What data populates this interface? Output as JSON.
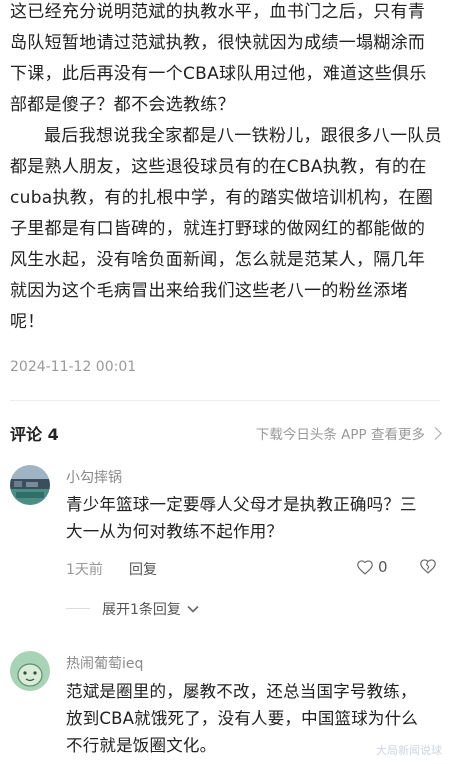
{
  "article": {
    "paragraphs": [
      "这已经充分说明范斌的执教水平，血书门之后，只有青岛队短暂地请过范斌执教，很快就因为成绩一塌糊涂而下课，此后再没有一个CBA球队用过他，难道这些俱乐部都是傻子？都不会选教练？",
      "最后我想说我全家都是八一铁粉儿，跟很多八一队员都是熟人朋友，这些退役球员有的在CBA执教，有的在cuba执教，有的扎根中学，有的踏实做培训机构，在圈子里都是有口皆碑的，就连打野球的做网红的都能做的风生水起，没有啥负面新闻，怎么就是范某人，隔几年就因为这个毛病冒出来给我们这些老八一的粉丝添堵呢！"
    ],
    "date": "2024-11-12 00:01"
  },
  "comments_header": {
    "title": "评论 4",
    "download_link": "下载今日头条 APP 查看更多"
  },
  "comments": [
    {
      "username": "小勾摔锅",
      "text": "青少年篮球一定要辱人父母才是执教正确吗？三大一从为何对教练不起作用？",
      "time": "1天前",
      "reply_label": "回复",
      "likes": "0",
      "expand_label": "展开1条回复"
    },
    {
      "username": "热闹葡萄ieq",
      "text": "范斌是圈里的，屡教不改，还总当国字号教练，放到CBA就饿死了，没有人要，中国篮球为什么不行就是饭圈文化。"
    }
  ],
  "watermark": "大局新闻说球",
  "colors": {
    "text": "#222222",
    "muted": "#999999",
    "divider": "#eeeeee"
  }
}
